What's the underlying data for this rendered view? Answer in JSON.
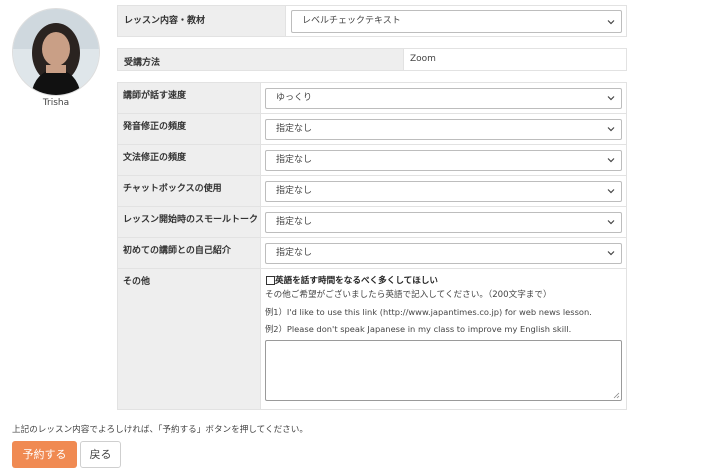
{
  "tutor": {
    "name": "Trisha"
  },
  "form": {
    "lesson_content": {
      "label": "レッスン内容・教材",
      "value": "レベルチェックテキスト"
    },
    "method": {
      "label": "受講方法",
      "value": "Zoom"
    },
    "rows": [
      {
        "label": "講師が話す速度",
        "value": "ゆっくり"
      },
      {
        "label": "発音修正の頻度",
        "value": "指定なし"
      },
      {
        "label": "文法修正の頻度",
        "value": "指定なし"
      },
      {
        "label": "チャットボックスの使用",
        "value": "指定なし"
      },
      {
        "label": "レッスン開始時のスモールトーク",
        "value": "指定なし"
      },
      {
        "label": "初めての講師との自己紹介",
        "value": "指定なし"
      }
    ],
    "other": {
      "label": "その他",
      "checkbox_label": "英語を話す時間をなるべく多くしてほしい",
      "hint": "その他ご希望がございましたら英語で記入してください。（200文字まで）",
      "example1": "例1）I'd like to use this link (http://www.japantimes.co.jp) for web news lesson.",
      "example2": "例2）Please don't speak Japanese in my class to improve my English skill.",
      "textarea_value": ""
    }
  },
  "footer": {
    "note": "上記のレッスン内容でよろしければ、「予約する」ボタンを押してください。",
    "reserve_label": "予約する",
    "back_label": "戻る"
  },
  "colors": {
    "accent": "#f08a52",
    "label_bg": "#eeeeee"
  }
}
